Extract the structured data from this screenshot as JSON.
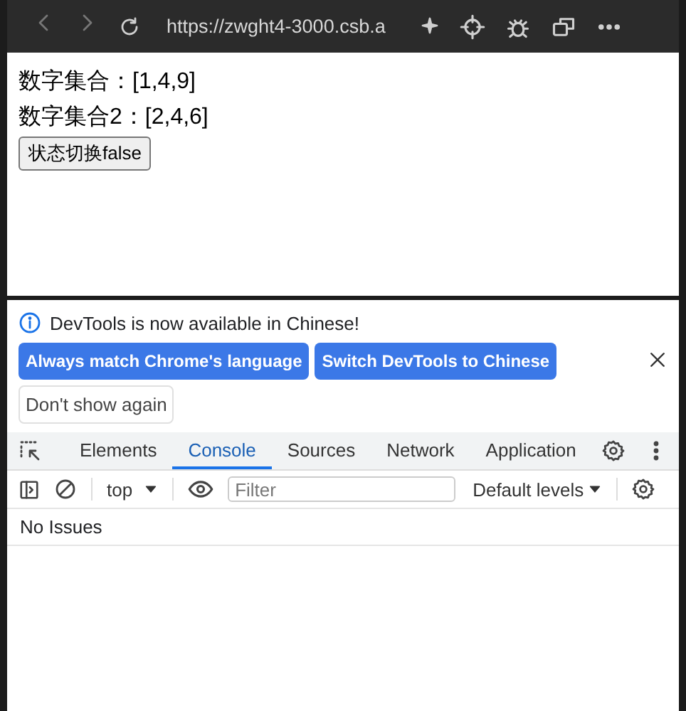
{
  "browser_toolbar": {
    "url": "https://zwght4-3000.csb.a"
  },
  "page": {
    "lines": [
      "数字集合：[1,4,9]",
      "数字集合2：[2,4,6]"
    ],
    "button": "状态切换false"
  },
  "devtools": {
    "infobar": {
      "message": "DevTools is now available in Chinese!",
      "buttons": [
        {
          "label": "Always match Chrome's language",
          "kind": "primary"
        },
        {
          "label": "Switch DevTools to Chinese",
          "kind": "primary"
        },
        {
          "label": "Don't show again",
          "kind": "secondary"
        }
      ]
    },
    "tabs": [
      {
        "label": "Elements",
        "selected": false
      },
      {
        "label": "Console",
        "selected": true
      },
      {
        "label": "Sources",
        "selected": false
      },
      {
        "label": "Network",
        "selected": false
      },
      {
        "label": "Application",
        "selected": false
      }
    ],
    "console_toolbar": {
      "context": "top",
      "filter": {
        "placeholder": "Filter"
      },
      "levels": "Default levels"
    },
    "issues": "No Issues"
  }
}
